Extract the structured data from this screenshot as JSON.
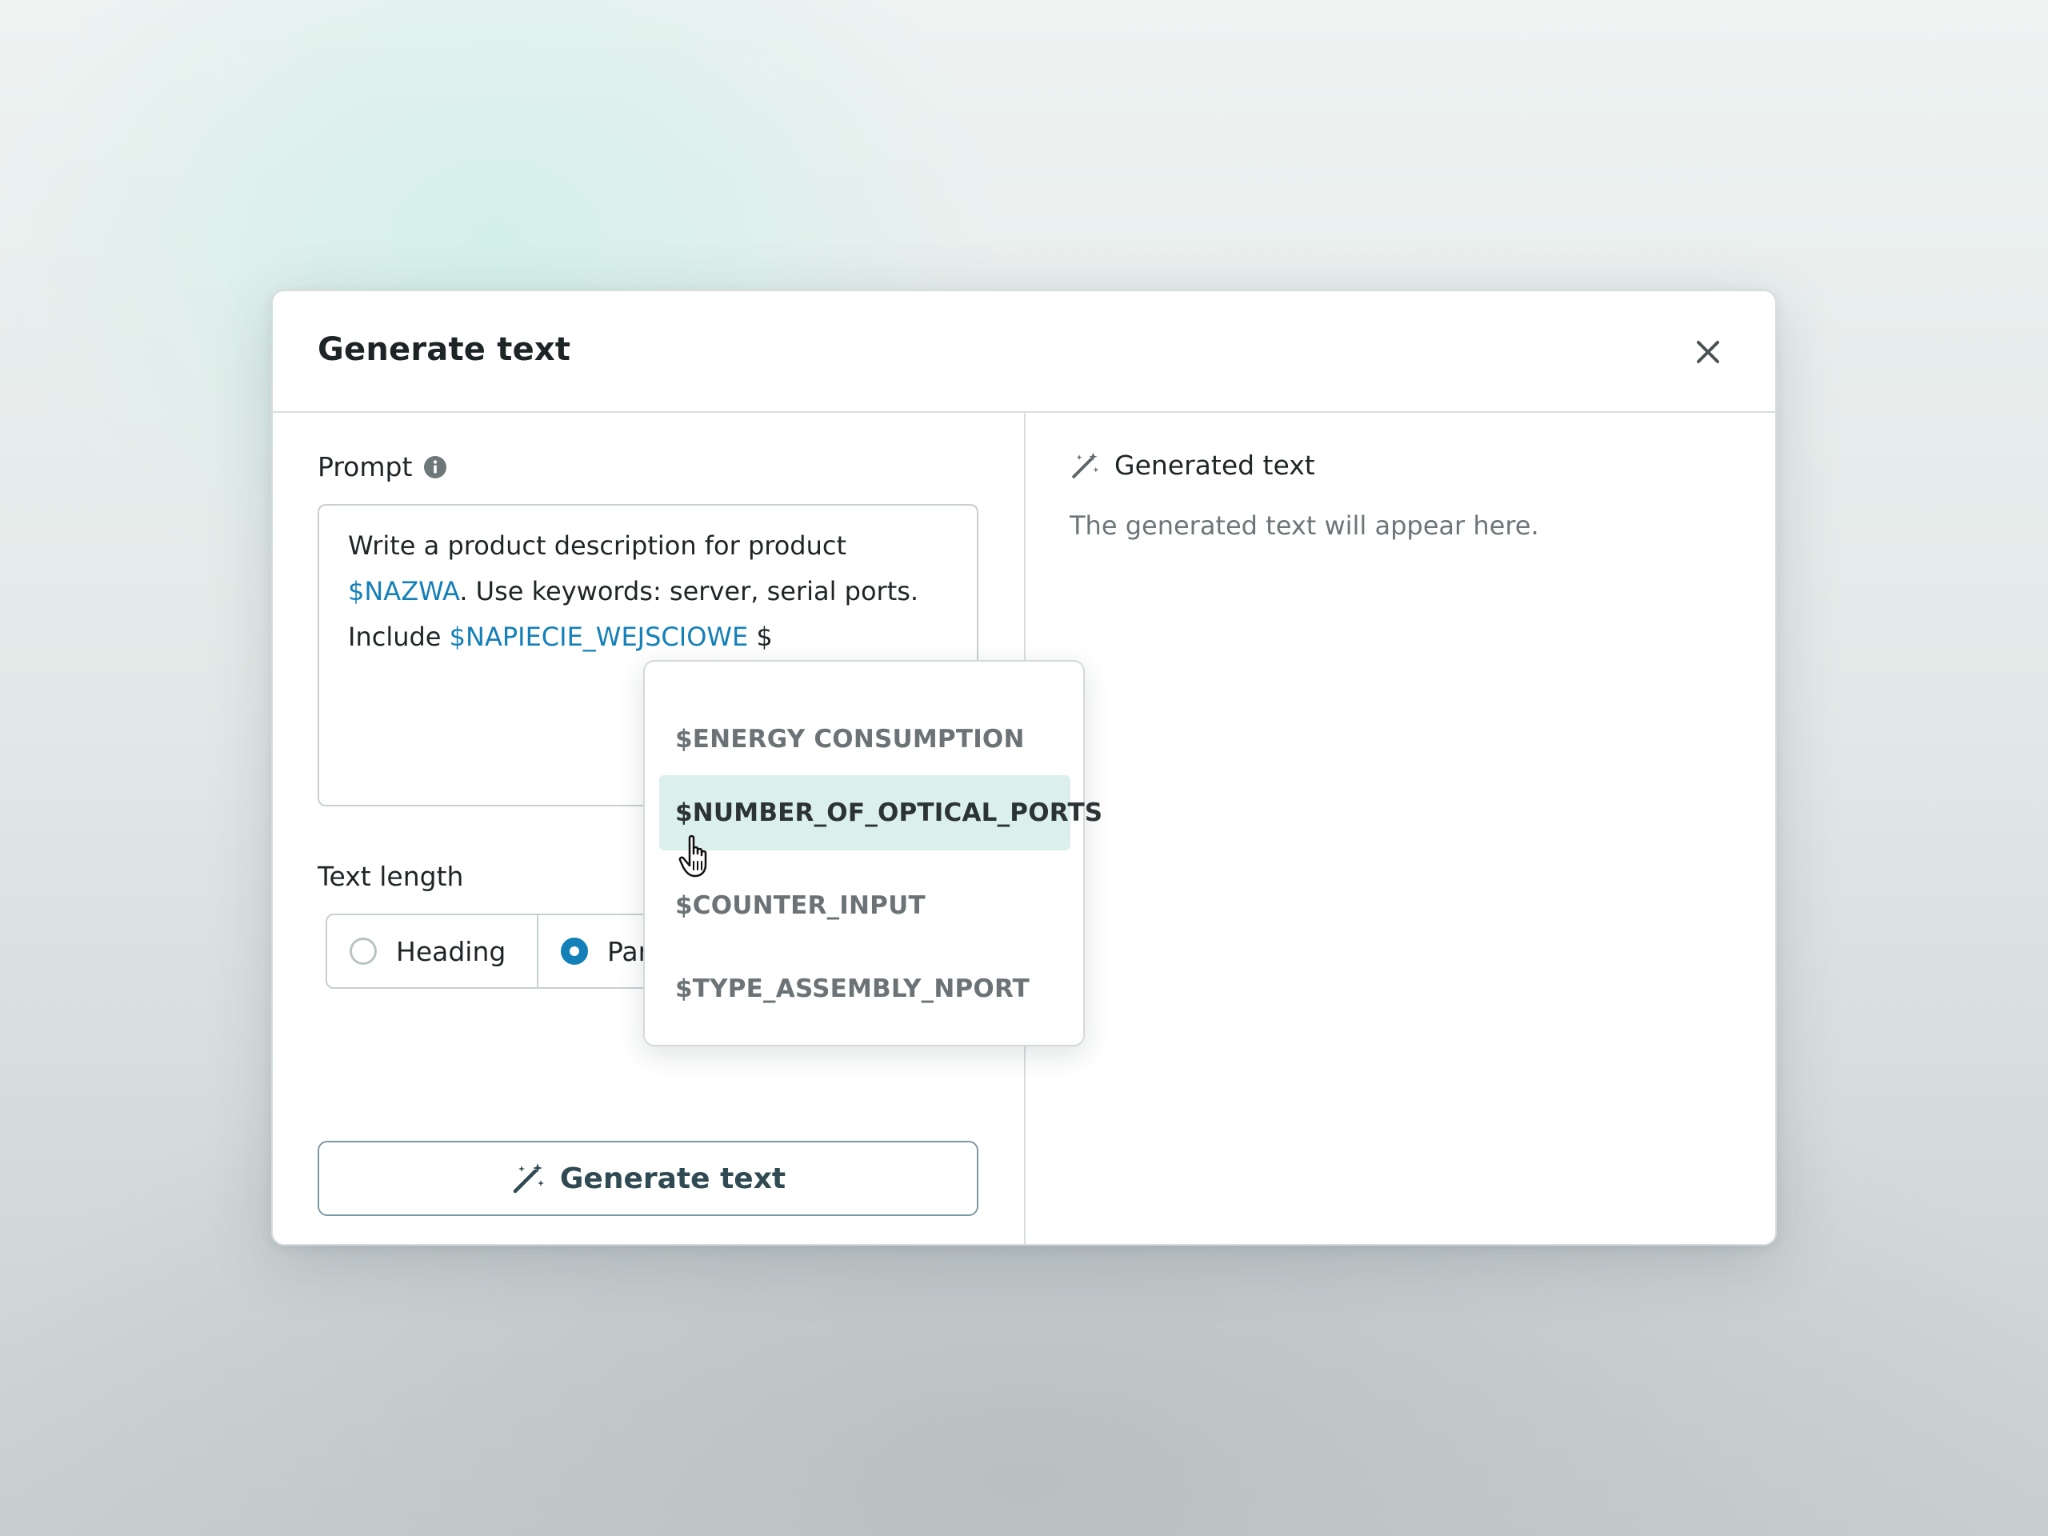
{
  "modal": {
    "title": "Generate text",
    "close_icon": "close-icon"
  },
  "prompt": {
    "label": "Prompt",
    "info_icon": "info-icon",
    "text_part1": "Write a product description for product ",
    "var1": "$NAZWA",
    "text_part2": ". Use keywords: server, serial ports. Include ",
    "var2": "$NAPIECIE_WEJSCIOWE",
    "text_part3": " $"
  },
  "text_length": {
    "label": "Text length",
    "options": [
      {
        "label": "Heading",
        "selected": false
      },
      {
        "label": "Par",
        "selected": true
      }
    ]
  },
  "generate_button": {
    "label": "Generate text",
    "icon": "magic-wand-icon"
  },
  "output": {
    "heading": "Generated text",
    "icon": "magic-wand-icon",
    "placeholder": "The generated text will appear here."
  },
  "variable_dropdown": {
    "items": [
      {
        "label": "$ENERGY CONSUMPTION",
        "highlighted": false
      },
      {
        "label": "$NUMBER_OF_OPTICAL_PORTS",
        "highlighted": true
      },
      {
        "label": "$COUNTER_INPUT",
        "highlighted": false
      },
      {
        "label": "$TYPE_ASSEMBLY_NPORT",
        "highlighted": false
      }
    ]
  },
  "colors": {
    "accent": "#1480b8",
    "highlight": "#dbf0ed",
    "button_border": "#7c9aa3"
  }
}
